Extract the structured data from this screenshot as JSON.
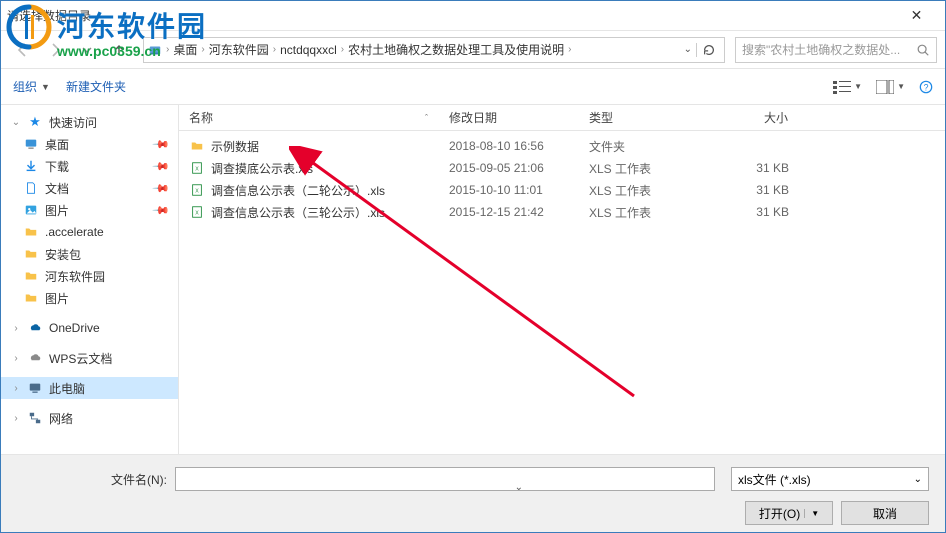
{
  "title": "请选择数据目录",
  "breadcrumb": {
    "items": [
      "桌面",
      "河东软件园",
      "nctdqqxxcl",
      "农村土地确权之数据处理工具及使用说明"
    ]
  },
  "search": {
    "placeholder": "搜索\"农村土地确权之数据处..."
  },
  "toolbar": {
    "organize": "组织",
    "new_folder": "新建文件夹"
  },
  "columns": {
    "name": "名称",
    "date": "修改日期",
    "type": "类型",
    "size": "大小"
  },
  "sidebar": {
    "quick": "快速访问",
    "desktop": "桌面",
    "downloads": "下载",
    "documents": "文档",
    "pictures": "图片",
    "accelerate": ".accelerate",
    "install_pkg": "安装包",
    "hedong": "河东软件园",
    "pictures2": "图片",
    "onedrive": "OneDrive",
    "wps": "WPS云文档",
    "this_pc": "此电脑",
    "network": "网络"
  },
  "files": [
    {
      "icon": "folder",
      "name": "示例数据",
      "date": "2018-08-10 16:56",
      "type": "文件夹",
      "size": ""
    },
    {
      "icon": "xls",
      "name": "调查摸底公示表.xls",
      "date": "2015-09-05 21:06",
      "type": "XLS 工作表",
      "size": "31 KB"
    },
    {
      "icon": "xls",
      "name": "调查信息公示表（二轮公示）.xls",
      "date": "2015-10-10 11:01",
      "type": "XLS 工作表",
      "size": "31 KB"
    },
    {
      "icon": "xls",
      "name": "调查信息公示表（三轮公示）.xls",
      "date": "2015-12-15 21:42",
      "type": "XLS 工作表",
      "size": "31 KB"
    }
  ],
  "footer": {
    "filename_label": "文件名(N):",
    "filename_value": "",
    "filter": "xls文件 (*.xls)",
    "open": "打开(O)",
    "cancel": "取消"
  },
  "watermark": {
    "title": "河东软件园",
    "url": "www.pc0359.cn"
  }
}
